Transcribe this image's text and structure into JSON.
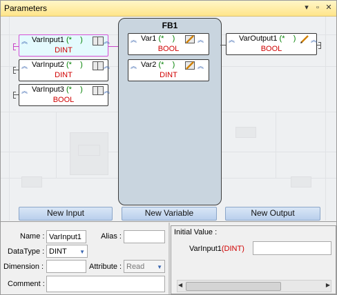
{
  "window": {
    "title": "Parameters"
  },
  "fb": {
    "name": "FB1"
  },
  "inputs": [
    {
      "name": "VarInput1",
      "open": "(",
      "star": "*",
      "close": ")",
      "type": "DINT"
    },
    {
      "name": "VarInput2",
      "open": "(",
      "star": "*",
      "close": ")",
      "type": "DINT"
    },
    {
      "name": "VarInput3",
      "open": "(",
      "star": "*",
      "close": ")",
      "type": "BOOL"
    }
  ],
  "variables": [
    {
      "name": "Var1",
      "open": "(",
      "star": "*",
      "close": ")",
      "type": "BOOL"
    },
    {
      "name": "Var2",
      "open": "(",
      "star": "*",
      "close": ")",
      "type": "DINT"
    }
  ],
  "outputs": [
    {
      "name": "VarOutput1",
      "open": "(",
      "star": "*",
      "close": ")",
      "type": "BOOL"
    }
  ],
  "buttons": {
    "new_input": "New Input",
    "new_variable": "New Variable",
    "new_output": "New Output"
  },
  "properties": {
    "name_label": "Name :",
    "name_value": "VarInput1",
    "alias_label": "Alias :",
    "alias_value": "",
    "datatype_label": "DataType :",
    "datatype_value": "DINT",
    "dimension_label": "Dimension :",
    "dimension_value": "",
    "attribute_label": "Attribute :",
    "attribute_value": "Read",
    "comment_label": "Comment :",
    "comment_value": ""
  },
  "initial_value": {
    "group_label": "Initial Value :",
    "var_name": "VarInput1",
    "var_type": "(DINT)",
    "value": ""
  },
  "colors": {
    "selected_border": "#d24fd6",
    "type_text": "#d00000",
    "comment_paren": "#008000",
    "title_bar": "#ffe58a"
  }
}
